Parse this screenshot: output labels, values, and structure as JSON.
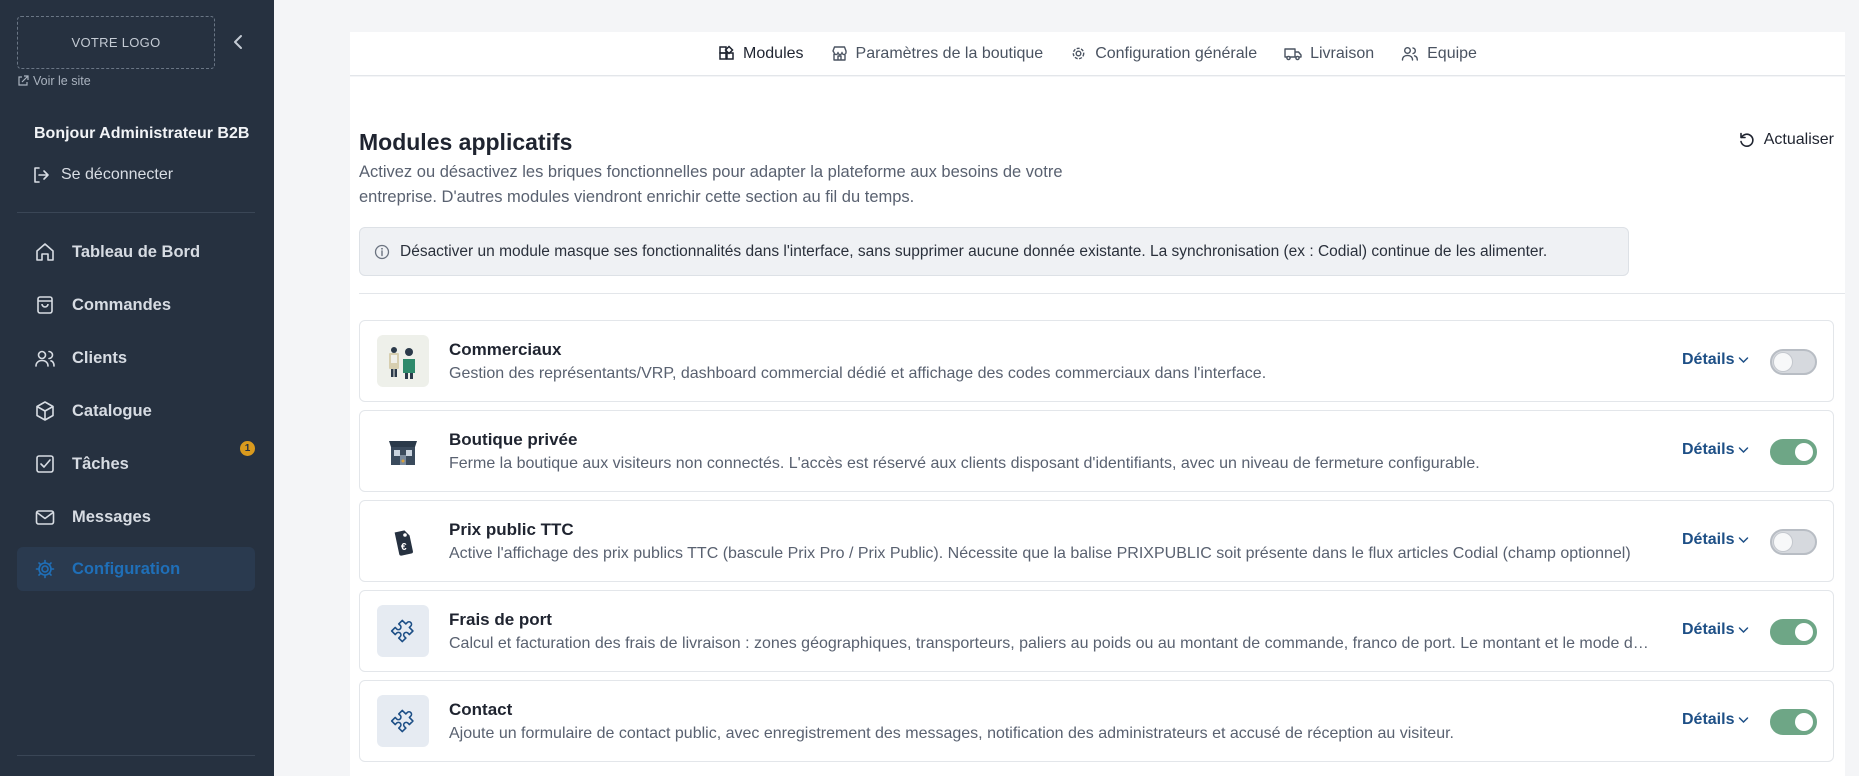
{
  "sidebar": {
    "logo_text": "VOTRE LOGO",
    "view_site": "Voir le site",
    "greeting": "Bonjour Administrateur B2B",
    "logout": "Se déconnecter",
    "items": [
      {
        "label": "Tableau de Bord",
        "icon": "home-icon"
      },
      {
        "label": "Commandes",
        "icon": "shopping-bag-icon"
      },
      {
        "label": "Clients",
        "icon": "users-icon"
      },
      {
        "label": "Catalogue",
        "icon": "box-icon"
      },
      {
        "label": "Tâches",
        "icon": "checkbox-icon",
        "badge": "1"
      },
      {
        "label": "Messages",
        "icon": "mail-icon"
      },
      {
        "label": "Configuration",
        "icon": "gear-icon",
        "active": true
      }
    ]
  },
  "tabs": [
    {
      "label": "Modules",
      "icon": "modules-icon",
      "active": true
    },
    {
      "label": "Paramètres de la boutique",
      "icon": "store-icon"
    },
    {
      "label": "Configuration générale",
      "icon": "gear-icon"
    },
    {
      "label": "Livraison",
      "icon": "truck-icon"
    },
    {
      "label": "Equipe",
      "icon": "team-icon"
    }
  ],
  "main": {
    "title": "Modules applicatifs",
    "description": "Activez ou désactivez les briques fonctionnelles pour adapter la plateforme aux besoins de votre entreprise. D'autres modules viendront enrichir cette section au fil du temps.",
    "refresh_label": "Actualiser",
    "info": "Désactiver un module masque ses fonctionnalités dans l'interface, sans supprimer aucune donnée existante. La synchronisation (ex : Codial) continue de les alimenter."
  },
  "modules": [
    {
      "title": "Commerciaux",
      "description": "Gestion des représentants/VRP, dashboard commercial dédié et affichage des codes commerciaux dans l'interface.",
      "details": "Détails",
      "enabled": false,
      "icon": "salesperson-icon"
    },
    {
      "title": "Boutique privée",
      "description": "Ferme la boutique aux visiteurs non connectés. L'accès est réservé aux clients disposant d'identifiants, avec un niveau de fermeture configurable.",
      "details": "Détails",
      "enabled": true,
      "icon": "private-store-icon"
    },
    {
      "title": "Prix public TTC",
      "description": "Active l'affichage des prix publics TTC (bascule Prix Pro / Prix Public). Nécessite que la balise PRIXPUBLIC soit présente dans le flux articles Codial (champ optionnel)",
      "details": "Détails",
      "enabled": false,
      "icon": "price-tag-icon"
    },
    {
      "title": "Frais de port",
      "description": "Calcul et facturation des frais de livraison : zones géographiques, transporteurs, paliers au poids ou au montant de commande, franco de port. Le montant et le mode de calcul",
      "details": "Détails",
      "enabled": true,
      "icon": "puzzle-icon"
    },
    {
      "title": "Contact",
      "description": "Ajoute un formulaire de contact public, avec enregistrement des messages, notification des administrateurs et accusé de réception au visiteur.",
      "details": "Détails",
      "enabled": true,
      "icon": "puzzle-icon"
    }
  ]
}
